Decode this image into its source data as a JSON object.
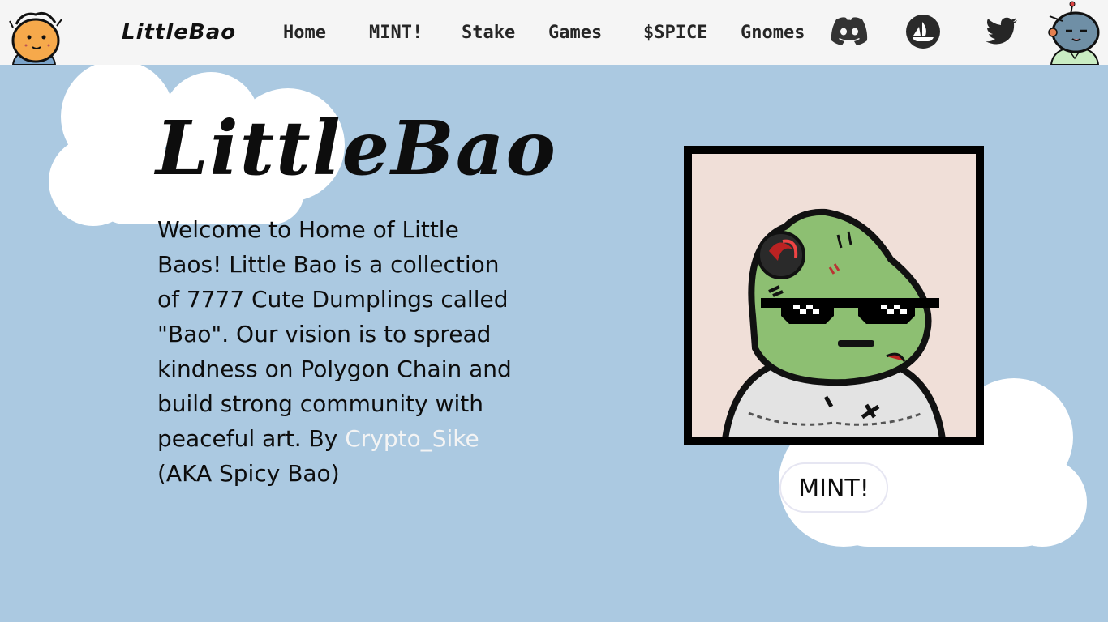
{
  "nav": {
    "brand": "LittleBao",
    "links": [
      "Home",
      "MINT!",
      "Stake",
      "Games",
      "$SPICE",
      "Gnomes"
    ],
    "social": [
      "discord-icon",
      "opensea-icon",
      "twitter-icon"
    ]
  },
  "hero": {
    "title": "LittleBao",
    "description": "Welcome to Home of Little Baos! Little Bao is a collection of 7777 Cute Dumplings called \"Bao\". Our vision is to spread kindness on Polygon Chain and build strong community with peaceful art. By",
    "author_link": "Crypto_Sike",
    "author_suffix": "(AKA Spicy Bao)"
  },
  "mint": {
    "label": "MINT!"
  },
  "colors": {
    "background": "#abc9e1",
    "navbar": "#f5f5f5",
    "link_highlight": "#f4f4f4",
    "frame": "#000000",
    "nft_bg": "#f0dfd8",
    "bao_green": "#8dbf72"
  }
}
